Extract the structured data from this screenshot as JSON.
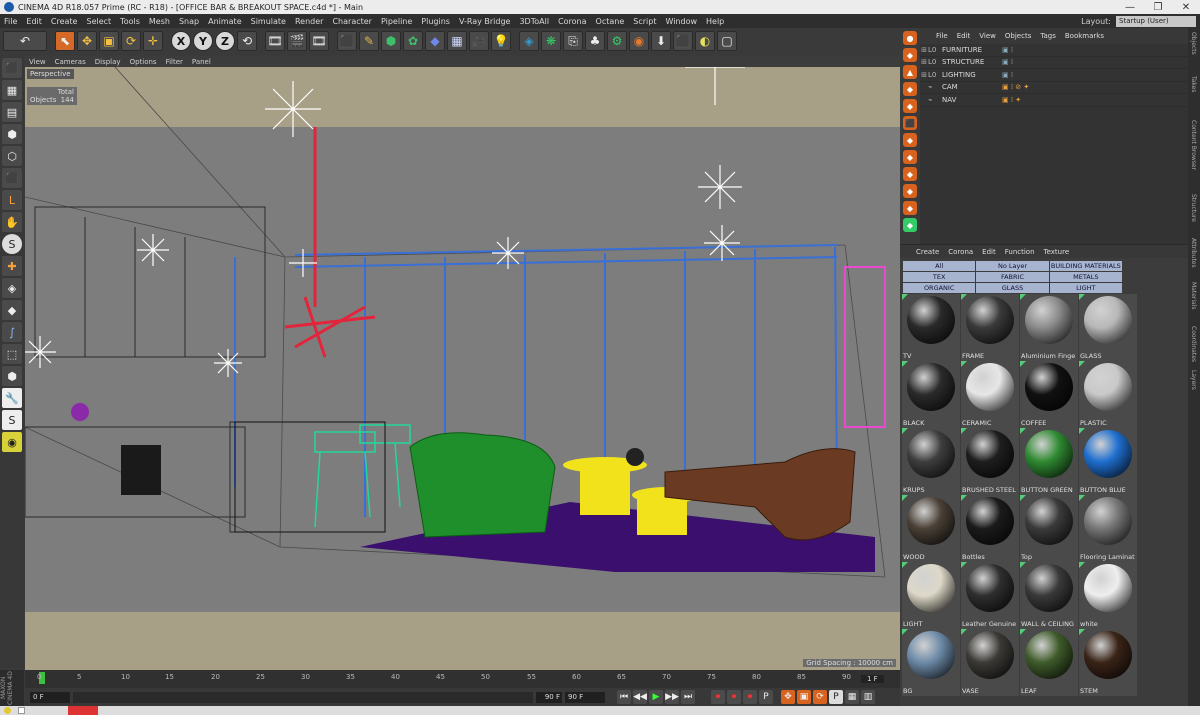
{
  "title_bar": {
    "title": "CINEMA 4D R18.057 Prime (RC - R18) - [OFFICE BAR & BREAKOUT SPACE.c4d *] - Main",
    "controls": [
      "—",
      "❐",
      "✕"
    ]
  },
  "menu": [
    "File",
    "Edit",
    "Create",
    "Select",
    "Tools",
    "Mesh",
    "Snap",
    "Animate",
    "Simulate",
    "Render",
    "Character",
    "Pipeline",
    "Plugins",
    "V-Ray Bridge",
    "3DToAll",
    "Corona",
    "Octane",
    "Script",
    "Window",
    "Help"
  ],
  "layout": {
    "label": "Layout:",
    "value": "Startup (User)"
  },
  "toolbar": {
    "undo": "↶",
    "tools": [
      "⬉",
      "✥",
      "▣",
      "⟳",
      "✛"
    ],
    "axes": [
      "X",
      "Y",
      "Z"
    ],
    "more": [
      "⟲",
      "🎞",
      "🎬",
      "🎞",
      "⬛",
      "✎",
      "⬢",
      "✿",
      "◆",
      "▦",
      "🎥",
      "💡",
      "◈",
      "❋",
      "⎘",
      "♣",
      "⚙",
      "◉",
      "⬇",
      "⬛",
      "◐",
      "▢"
    ]
  },
  "left_tools": [
    "⬛",
    "▦",
    "▤",
    "⬢",
    "⬡",
    "⬛",
    "L",
    "✋",
    "S",
    "✚",
    "◈",
    "◆",
    "∫",
    "⬚",
    "⬢",
    "🔧",
    "S",
    "◉"
  ],
  "viewport": {
    "menu": [
      "View",
      "Cameras",
      "Display",
      "Options",
      "Filter",
      "Panel"
    ],
    "label": "Perspective",
    "stats_label": "Total",
    "objects_label": "Objects",
    "objects_count": "144",
    "grid_spacing": "Grid Spacing : 10000 cm"
  },
  "timeline": {
    "ticks": [
      "0",
      "5",
      "10",
      "15",
      "20",
      "25",
      "30",
      "35",
      "40",
      "45",
      "50",
      "55",
      "60",
      "65",
      "70",
      "75",
      "80",
      "85",
      "90"
    ],
    "frame_end_right": "1 F"
  },
  "playback": {
    "start": "0 F",
    "current": "0 F",
    "end": "90 F",
    "end2": "90 F",
    "buttons": [
      "⏮",
      "◀◀",
      "▶",
      "▶▶",
      "⏭",
      "⏺",
      "⏺",
      "⏺",
      "P",
      "✥",
      "▣",
      "⟳",
      "P",
      "▦",
      "▥"
    ]
  },
  "maxon": "MAXON CINEMA 4D",
  "object_manager": {
    "menu": [
      "File",
      "Edit",
      "View",
      "Objects",
      "Tags",
      "Bookmarks"
    ],
    "rows": [
      {
        "name": "FURNITURE",
        "layer": "L0",
        "flags": "▣ ⁞"
      },
      {
        "name": "STRUCTURE",
        "layer": "L0",
        "flags": "▣ ⁞"
      },
      {
        "name": "LIGHTING",
        "layer": "L0",
        "flags": "▣ ⁞"
      },
      {
        "name": "CAM",
        "layer": "⌁",
        "flags": "▣ ⁞ ⊘ ✦"
      },
      {
        "name": "NAV",
        "layer": "⌁",
        "flags": "▣ ⁞ ✦"
      }
    ]
  },
  "right_icons": [
    "●",
    "◆",
    "▲",
    "◆",
    "◆",
    "⬛",
    "◆",
    "◆",
    "◆",
    "◆",
    "◆",
    "◆",
    "◆",
    "◆"
  ],
  "side_tabs": [
    "Objects",
    "Takes",
    "Content Browser",
    "Structure",
    "Attributes",
    "Materials",
    "Coordinates",
    "Layers"
  ],
  "material_manager": {
    "menu": [
      "Create",
      "Corona",
      "Edit",
      "Function",
      "Texture"
    ],
    "filters": [
      [
        "All",
        "No Layer",
        "BUILDING MATERIALS"
      ],
      [
        "TEX",
        "FABRIC",
        "METALS"
      ],
      [
        "ORGANIC",
        "GLASS",
        "LIGHT"
      ]
    ],
    "materials": [
      {
        "name": "TV",
        "color": "#2a2a2a"
      },
      {
        "name": "FRAME",
        "color": "#3a3a3a"
      },
      {
        "name": "Aluminium Finge",
        "color": "#8c8c8c"
      },
      {
        "name": "GLASS",
        "color": "#b8b8b8"
      },
      {
        "name": "BLACK",
        "color": "#2b2b2b"
      },
      {
        "name": "CERAMIC",
        "color": "#e6e6e6"
      },
      {
        "name": "COFFEE",
        "color": "#111111"
      },
      {
        "name": "PLASTIC",
        "color": "#c9c9c9"
      },
      {
        "name": "KRUPS",
        "color": "#3e3e3e"
      },
      {
        "name": "BRUSHED STEEL",
        "color": "#1e1e1e"
      },
      {
        "name": "BUTTON GREEN",
        "color": "#2f8a32"
      },
      {
        "name": "BUTTON BLUE",
        "color": "#1f6fd0"
      },
      {
        "name": "WOOD",
        "color": "#4a4036"
      },
      {
        "name": "Bottles",
        "color": "#1b1b1b"
      },
      {
        "name": "Top",
        "color": "#3b3b3b"
      },
      {
        "name": "Flooring Laminat",
        "color": "#777777"
      },
      {
        "name": "LIGHT",
        "color": "#ddd8c8"
      },
      {
        "name": "Leather Genuine",
        "color": "#2f2f2f"
      },
      {
        "name": "WALL & CEILING",
        "color": "#3a3a3a"
      },
      {
        "name": "white",
        "color": "#eeeeee"
      },
      {
        "name": "BG",
        "color": "#6d8aa8"
      },
      {
        "name": "VASE",
        "color": "#3c3a36"
      },
      {
        "name": "LEAF",
        "color": "#3f5b2a"
      },
      {
        "name": "STEM",
        "color": "#3a2418"
      }
    ]
  }
}
